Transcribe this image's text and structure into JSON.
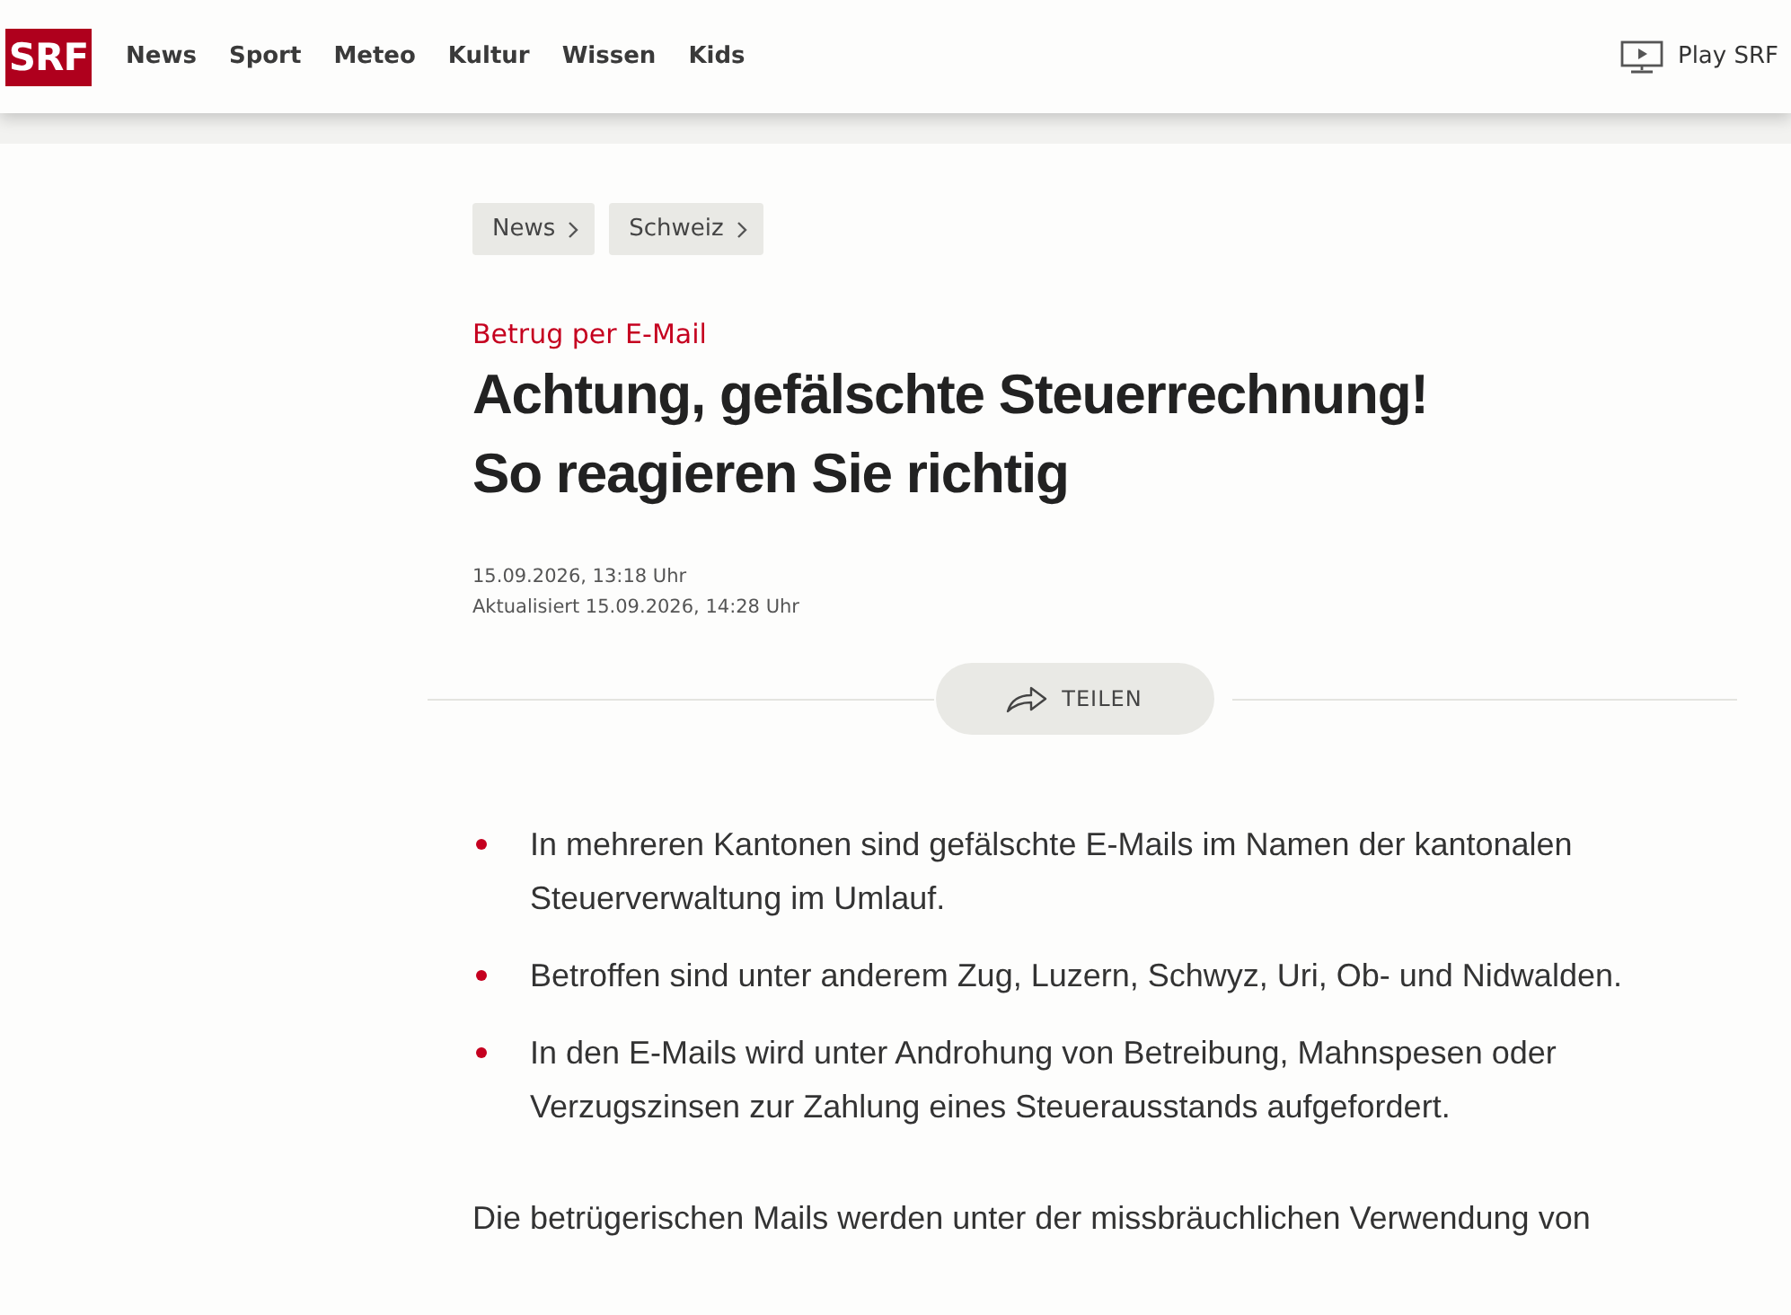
{
  "header": {
    "logo": "SRF",
    "nav": [
      {
        "label": "News"
      },
      {
        "label": "Sport"
      },
      {
        "label": "Meteo"
      },
      {
        "label": "Kultur"
      },
      {
        "label": "Wissen"
      },
      {
        "label": "Kids"
      }
    ],
    "play": "Play SRF"
  },
  "breadcrumbs": [
    {
      "label": "News"
    },
    {
      "label": "Schweiz"
    }
  ],
  "article": {
    "kicker": "Betrug per E-Mail",
    "title_lines": [
      "Achtung, gefälschte Steuerrechnung!",
      "So reagieren Sie richtig"
    ],
    "published": "15.09.2026, 13:18 Uhr",
    "updated": "Aktualisiert 15.09.2026, 14:28 Uhr",
    "share": "TEILEN",
    "bullets": [
      "In mehreren Kantonen sind gefälschte E-Mails im Namen der kantonalen Steuerverwaltung im Umlauf.",
      "Betroffen sind unter anderem Zug, Luzern, Schwyz, Uri, Ob- und Nidwalden.",
      "In den E-Mails wird unter Androhung von Betreibung, Mahnspesen oder Verzugszinsen zur Zahlung eines Steuerausstands aufgefordert."
    ],
    "paragraph": "Die betrügerischen Mails werden unter der missbräuchlichen Verwendung von"
  }
}
